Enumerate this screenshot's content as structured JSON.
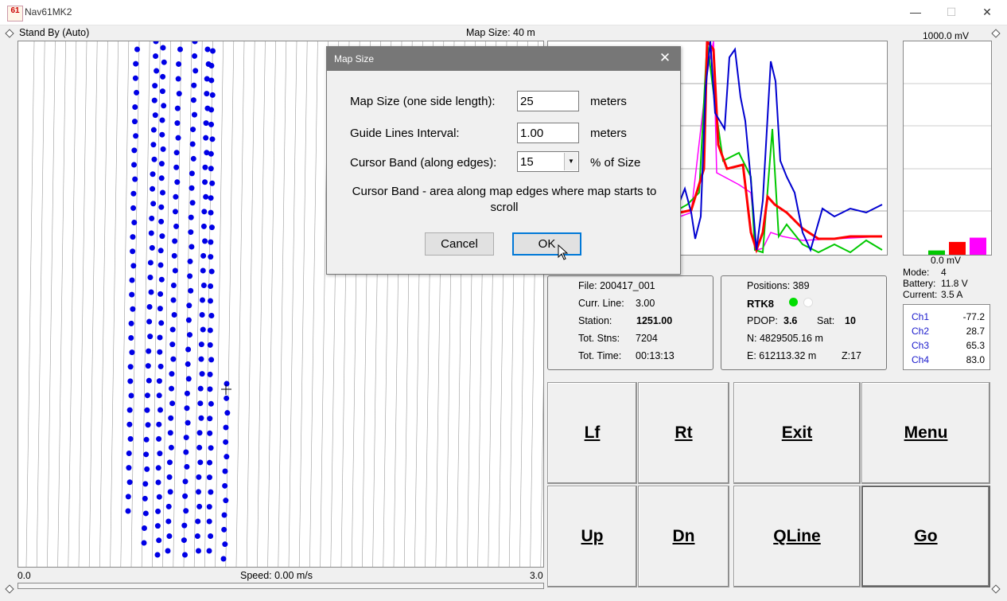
{
  "window": {
    "title": "Nav61MK2",
    "icon_text": "61",
    "minimize": "—",
    "maximize": "☐",
    "close": "✕"
  },
  "map": {
    "status": "Stand By (Auto)",
    "size_label": "Map Size:  40 m",
    "bottom_left": "0.0",
    "speed": "Speed:  0.00 m/s",
    "bottom_right": "3.0"
  },
  "graph": {
    "top_label": "1000.0 mV",
    "bottom_label": "0.0 mV",
    "colors": {
      "ch1": "#0000d0",
      "ch2": "#00c800",
      "ch3": "#ff0000",
      "ch4": "#ff00ff"
    },
    "bar_levels": [
      0.02,
      0.06,
      0.08
    ]
  },
  "status": {
    "mode_label": "Mode:",
    "mode_value": "4",
    "battery_label": "Battery:",
    "battery_value": "11.8 V",
    "current_label": "Current:",
    "current_value": "3.5 A"
  },
  "channels": [
    {
      "name": "Ch1",
      "value": "-77.2"
    },
    {
      "name": "Ch2",
      "value": "28.7"
    },
    {
      "name": "Ch3",
      "value": "65.3"
    },
    {
      "name": "Ch4",
      "value": "83.0"
    }
  ],
  "file_panel": {
    "file": "File: 200417_001",
    "curr_line_label": "Curr. Line:",
    "curr_line_value": "3.00",
    "station_label": "Station:",
    "station_value": "1251.00",
    "tot_stns_label": "Tot. Stns:",
    "tot_stns_value": "7204",
    "tot_time_label": "Tot. Time:",
    "tot_time_value": "00:13:13"
  },
  "gps_panel": {
    "positions": "Positions:  389",
    "fix": "RTK8",
    "pdop_label": "PDOP:",
    "pdop_value": "3.6",
    "sat_label": "Sat:",
    "sat_value": "10",
    "north": "N:  4829505.16 m",
    "east": "E:   612113.32 m",
    "zone": "Z:17",
    "dot_colors": [
      "#00dd00",
      "#ffffff"
    ]
  },
  "buttons": {
    "lf": "Lf",
    "rt": "Rt",
    "exit": "Exit",
    "menu": "Menu",
    "up": "Up",
    "dn": "Dn",
    "qline": "QLine",
    "go": "Go"
  },
  "dialog": {
    "title": "Map Size",
    "close": "✕",
    "map_size_label": "Map Size (one side length):",
    "map_size_value": "25",
    "map_size_unit": "meters",
    "guide_label": "Guide Lines Interval:",
    "guide_value": "1.00",
    "guide_unit": "meters",
    "band_label": "Cursor Band (along edges):",
    "band_value": "15",
    "band_unit": "% of Size",
    "note": "Cursor Band - area along map edges where map starts to scroll",
    "cancel": "Cancel",
    "ok": "OK"
  }
}
